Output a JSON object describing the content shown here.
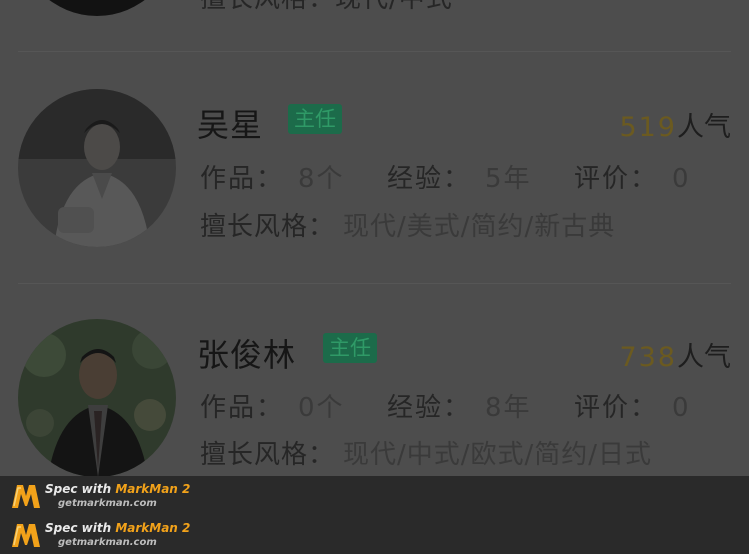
{
  "partial_item": {
    "style_text": "擅长风格：现代/中式"
  },
  "designers": [
    {
      "name": "吴星",
      "title_badge": "主任",
      "popularity_num": "519",
      "popularity_unit": "人气",
      "works_label": "作品：",
      "works_value": "8个",
      "experience_label": "经验：",
      "experience_value": "5年",
      "rating_label": "评价：",
      "rating_value": "0",
      "style_label": "擅长风格：",
      "style_value": "现代/美式/简约/新古典"
    },
    {
      "name": "张俊林",
      "title_badge": "主任",
      "popularity_num": "738",
      "popularity_unit": "人气",
      "works_label": "作品：",
      "works_value": "0个",
      "experience_label": "经验：",
      "experience_value": "8年",
      "rating_label": "评价：",
      "rating_value": "0",
      "style_label": "擅长风格：",
      "style_value": "现代/中式/欧式/简约/日式"
    }
  ],
  "watermark": {
    "line1_prefix": "Spec with ",
    "line1_brand": "MarkMan 2",
    "line2": "getmarkman.com"
  },
  "colors": {
    "overlay": "#4d4d4d",
    "badge_bg": "#1c6b4a",
    "popularity_num": "#6b5a20",
    "brand_orange": "#f2a21a"
  }
}
